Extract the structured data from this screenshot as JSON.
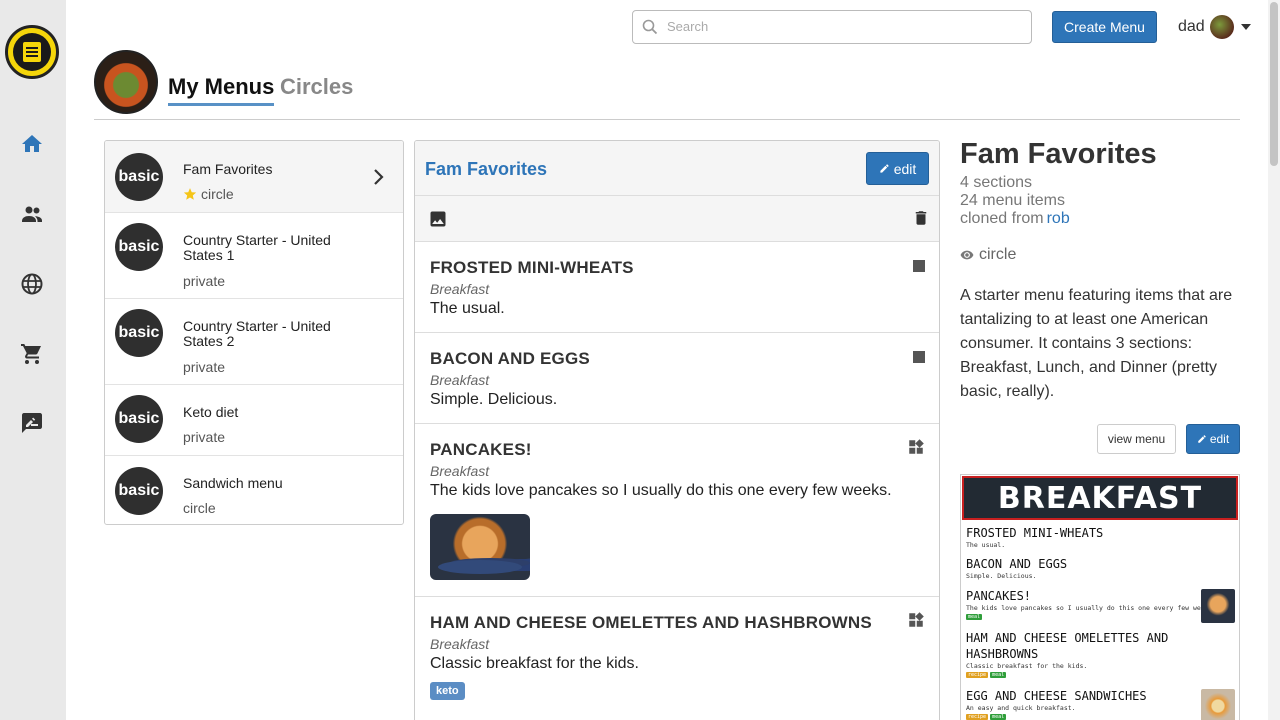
{
  "nav": {
    "logo": "menu-logo-icon",
    "items": [
      {
        "icon": "home-icon",
        "active": true
      },
      {
        "icon": "people-icon",
        "active": false
      },
      {
        "icon": "globe-icon",
        "active": false
      },
      {
        "icon": "cart-icon",
        "active": false
      },
      {
        "icon": "rate-review-icon",
        "active": false
      }
    ]
  },
  "topbar": {
    "search_placeholder": "Search",
    "search_value": "",
    "create_label": "Create Menu",
    "user_name": "dad"
  },
  "header": {
    "tabs": [
      "My Menus",
      "Circles"
    ],
    "active_tab": "My Menus"
  },
  "menus": [
    {
      "badge": "basic",
      "name": "Fam Favorites",
      "visibility": "circle",
      "starred": true,
      "active": true
    },
    {
      "badge": "basic",
      "name": "Country Starter - United States 1",
      "visibility": "private"
    },
    {
      "badge": "basic",
      "name": "Country Starter - United States 2",
      "visibility": "private"
    },
    {
      "badge": "basic",
      "name": "Keto diet",
      "visibility": "private"
    },
    {
      "badge": "basic",
      "name": "Sandwich menu",
      "visibility": "circle"
    }
  ],
  "editor": {
    "title": "Fam Favorites",
    "edit_label": "edit",
    "items": [
      {
        "name": "FROSTED MINI-WHEATS",
        "section": "Breakfast",
        "description": "The usual.",
        "icon": "square-icon"
      },
      {
        "name": "BACON AND EGGS",
        "section": "Breakfast",
        "description": "Simple. Delicious.",
        "icon": "square-icon"
      },
      {
        "name": "PANCAKES!",
        "section": "Breakfast",
        "description": "The kids love pancakes so I usually do this one every few weeks.",
        "icon": "widgets-icon",
        "image": "pancakes-photo"
      },
      {
        "name": "HAM AND CHEESE OMELETTES AND HASHBROWNS",
        "section": "Breakfast",
        "description": "Classic breakfast for the kids.",
        "icon": "widgets-icon",
        "tag": "keto"
      }
    ]
  },
  "details": {
    "title": "Fam Favorites",
    "sections": "4 sections",
    "items": "24 menu items",
    "cloned_label": "cloned from",
    "cloned_user": "rob",
    "visibility": "circle",
    "description": "A starter menu featuring items that are tantalizing to at least one American consumer. It contains 3 sections: Breakfast, Lunch, and Dinner (pretty basic, really).",
    "view_label": "view menu",
    "edit_label": "edit"
  },
  "preview": {
    "banner": "BREAKFAST",
    "items": [
      {
        "name": "FROSTED MINI-WHEATS",
        "desc": "The usual."
      },
      {
        "name": "BACON AND EGGS",
        "desc": "Simple. Delicious."
      },
      {
        "name": "PANCAKES!",
        "desc": "The kids love pancakes so I usually do this one every few weeks.",
        "tags": [
          "meal"
        ]
      },
      {
        "name": "HAM AND CHEESE OMELETTES AND HASHBROWNS",
        "desc": "Classic breakfast for the kids.",
        "tags": [
          "recipe",
          "meal"
        ]
      },
      {
        "name": "EGG AND CHEESE SANDWICHES",
        "desc": "An easy and quick breakfast.",
        "tags": [
          "recipe",
          "meal"
        ]
      }
    ]
  },
  "colors": {
    "accent": "#2e75b8",
    "sidebar": "#e9e9e9",
    "badge": "#2f2f2f",
    "star": "#f5c518"
  }
}
